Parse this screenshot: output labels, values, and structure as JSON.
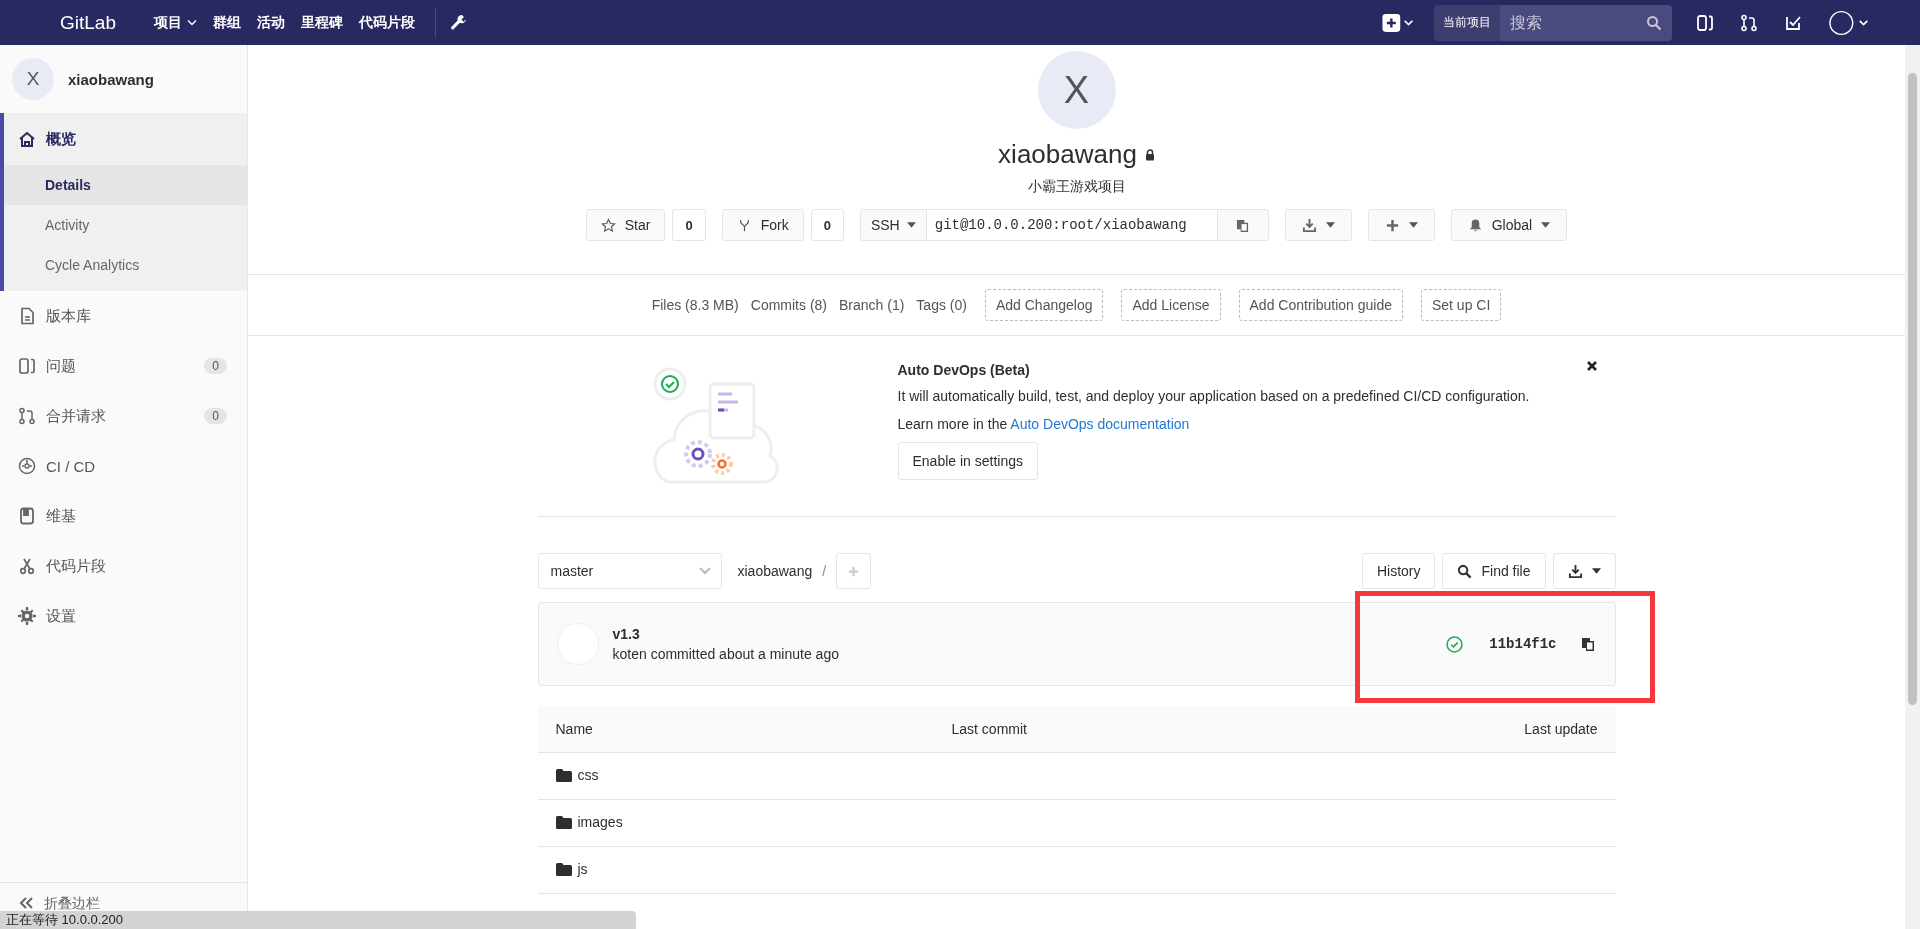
{
  "navbar": {
    "logo": "GitLab",
    "menu": [
      {
        "label": "项目",
        "dropdown": true
      },
      {
        "label": "群组",
        "dropdown": false
      },
      {
        "label": "活动",
        "dropdown": false
      },
      {
        "label": "里程碑",
        "dropdown": false
      },
      {
        "label": "代码片段",
        "dropdown": false
      }
    ],
    "scope": "当前项目",
    "search": {
      "placeholder": "搜索"
    }
  },
  "sidebar": {
    "project": {
      "avatar": "X",
      "name": "xiaobawang"
    },
    "items": [
      {
        "label": "概览",
        "selected": true,
        "children": [
          {
            "label": "Details",
            "selected": true
          },
          {
            "label": "Activity",
            "selected": false
          },
          {
            "label": "Cycle Analytics",
            "selected": false
          }
        ]
      },
      {
        "label": "版本库",
        "selected": false
      },
      {
        "label": "问题",
        "selected": false,
        "count": "0"
      },
      {
        "label": "合并请求",
        "selected": false,
        "count": "0"
      },
      {
        "label": "CI / CD",
        "selected": false
      },
      {
        "label": "维基",
        "selected": false
      },
      {
        "label": "代码片段",
        "selected": false
      },
      {
        "label": "设置",
        "selected": false
      }
    ],
    "collapse": "折叠边栏"
  },
  "project": {
    "avatar": "X",
    "name": "xiaobawang",
    "private": true,
    "description": "小霸王游戏项目",
    "star": {
      "label": "Star",
      "count": "0"
    },
    "fork": {
      "label": "Fork",
      "count": "0"
    },
    "protocol": "SSH",
    "clone_url": "git@10.0.0.200:root/xiaobawang",
    "notification": "Global"
  },
  "stats": [
    {
      "label": "Files (8.3 MB)",
      "kind": "link"
    },
    {
      "label": "Commits (8)",
      "kind": "link"
    },
    {
      "label": "Branch (1)",
      "kind": "link"
    },
    {
      "label": "Tags (0)",
      "kind": "link"
    },
    {
      "label": "Add Changelog",
      "kind": "dashed"
    },
    {
      "label": "Add License",
      "kind": "dashed"
    },
    {
      "label": "Add Contribution guide",
      "kind": "dashed"
    },
    {
      "label": "Set up CI",
      "kind": "dashed"
    }
  ],
  "auto_devops": {
    "title": "Auto DevOps (Beta)",
    "text": "It will automatically build, test, and deploy your application based on a predefined CI/CD configuration.",
    "learn_more": "Learn more in the",
    "link": "Auto DevOps documentation",
    "button": "Enable in settings"
  },
  "tree": {
    "branch": "master",
    "path": "xiaobawang",
    "separator": "/",
    "history": "History",
    "find": "Find file"
  },
  "commit": {
    "title": "v1.3",
    "author_line": "koten committed about a minute ago",
    "sha": "11b14f1c"
  },
  "files": {
    "columns": [
      "Name",
      "Last commit",
      "Last update"
    ],
    "rows": [
      {
        "name": "css"
      },
      {
        "name": "images"
      },
      {
        "name": "js"
      }
    ]
  },
  "status_bar": "正在等待 10.0.0.200"
}
